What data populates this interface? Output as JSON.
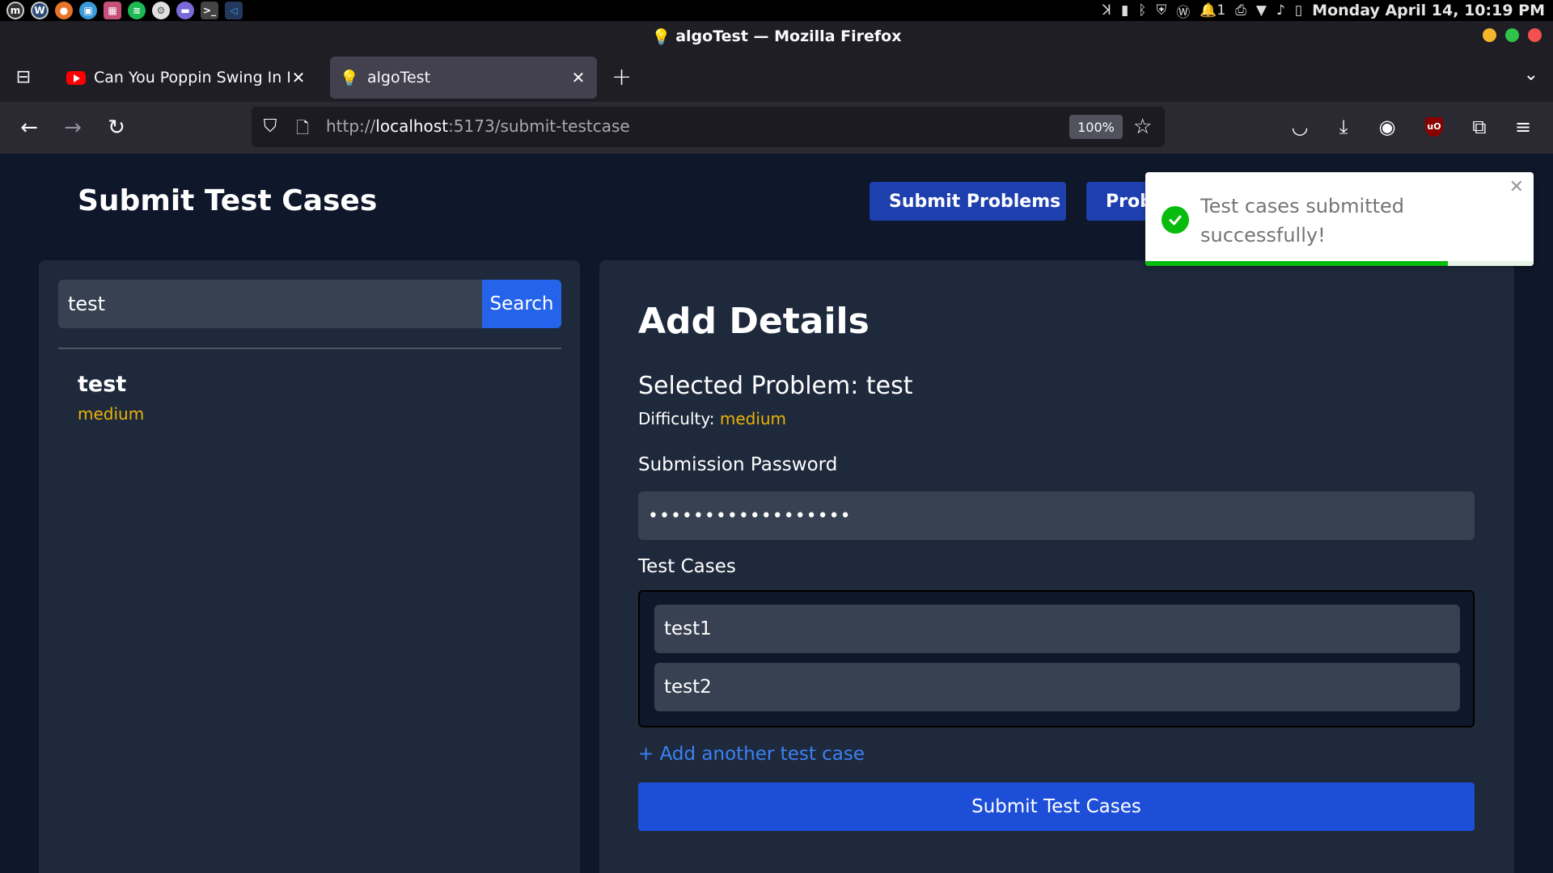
{
  "os": {
    "clock": "Monday April 14, 10:19 PM",
    "notif_count": "1"
  },
  "browser": {
    "window_title": "algoTest — Mozilla Firefox",
    "tabs": [
      {
        "label": "Can You Poppin Swing In Every",
        "favicon": "youtube-icon",
        "close": "✕"
      },
      {
        "label": "algoTest",
        "favicon": "lightbulb-icon",
        "close": "✕"
      }
    ],
    "url_scheme": "http://",
    "url_host": "localhost",
    "url_path": ":5173/submit-testcase",
    "zoom": "100%",
    "new_tab": "+"
  },
  "header": {
    "title": "Submit Test Cases",
    "btn_submit_problems": "Submit Problems",
    "btn_problems": "Problems"
  },
  "search": {
    "value": "test",
    "button": "Search"
  },
  "results": [
    {
      "title": "test",
      "difficulty": "medium"
    }
  ],
  "form": {
    "title": "Add Details",
    "selected_prefix": "Selected Problem: ",
    "selected_problem": "test",
    "difficulty_label": "Difficulty: ",
    "difficulty_value": "medium",
    "password_label": "Submission Password",
    "password_value": "••••••••••••••••••",
    "testcases_label": "Test Cases",
    "testcases": [
      "test1",
      "test2"
    ],
    "add_link": "+ Add another test case",
    "submit": "Submit Test Cases"
  },
  "toast": {
    "message": "Test cases submitted successfully!",
    "close": "✕",
    "progress": 0.78
  },
  "colors": {
    "page_bg": "#0f172a",
    "panel_bg": "#1e293b",
    "input_bg": "#374151",
    "accent_blue": "#1d4ed8",
    "difficulty_medium": "#eab308",
    "success_green": "#07bc0c"
  }
}
